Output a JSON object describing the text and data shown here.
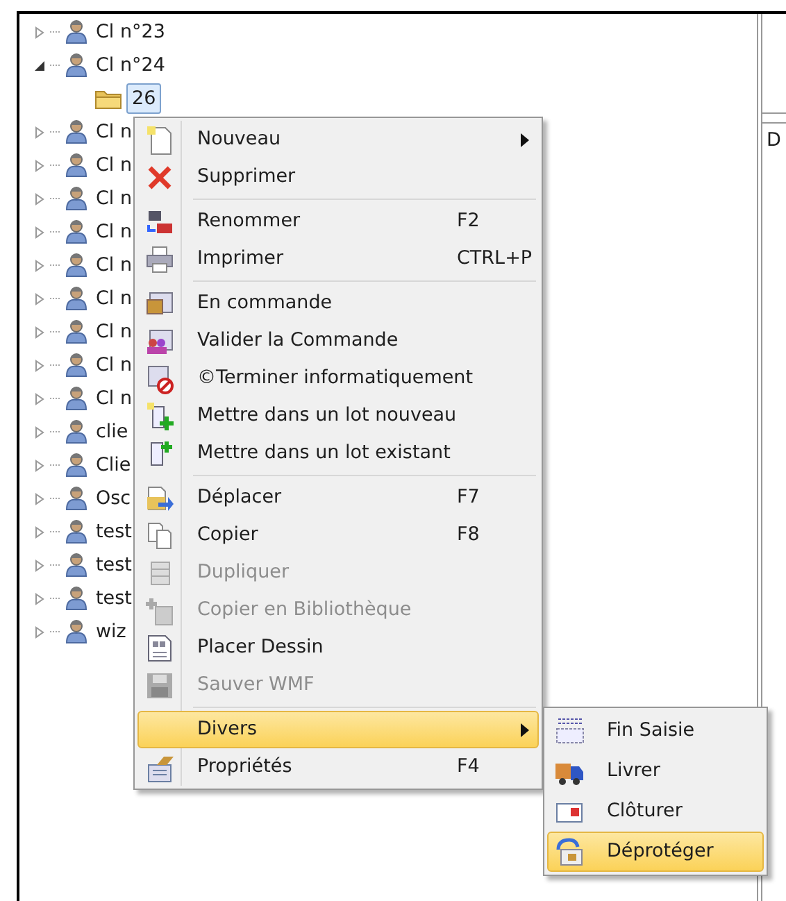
{
  "tree": {
    "items": [
      {
        "kind": "client",
        "label": "Cl n°23",
        "expanded": false,
        "selected": false
      },
      {
        "kind": "client",
        "label": "Cl n°24",
        "expanded": true,
        "selected": false,
        "children": [
          {
            "kind": "folder",
            "label": "26",
            "selected": true
          }
        ]
      },
      {
        "kind": "client",
        "label": "Cl n",
        "expanded": false,
        "selected": false
      },
      {
        "kind": "client",
        "label": "Cl n",
        "expanded": false,
        "selected": false
      },
      {
        "kind": "client",
        "label": "Cl n",
        "expanded": false,
        "selected": false
      },
      {
        "kind": "client",
        "label": "Cl n",
        "expanded": false,
        "selected": false
      },
      {
        "kind": "client",
        "label": "Cl n",
        "expanded": false,
        "selected": false
      },
      {
        "kind": "client",
        "label": "Cl n",
        "expanded": false,
        "selected": false
      },
      {
        "kind": "client",
        "label": "Cl n",
        "expanded": false,
        "selected": false
      },
      {
        "kind": "client",
        "label": "Cl n",
        "expanded": false,
        "selected": false
      },
      {
        "kind": "client",
        "label": "Cl n",
        "expanded": false,
        "selected": false
      },
      {
        "kind": "client",
        "label": "clie",
        "expanded": false,
        "selected": false
      },
      {
        "kind": "client",
        "label": "Clie",
        "expanded": false,
        "selected": false
      },
      {
        "kind": "client",
        "label": "Osc",
        "expanded": false,
        "selected": false
      },
      {
        "kind": "client",
        "label": "test",
        "expanded": false,
        "selected": false
      },
      {
        "kind": "client",
        "label": "test",
        "expanded": false,
        "selected": false
      },
      {
        "kind": "client",
        "label": "test",
        "expanded": false,
        "selected": false
      },
      {
        "kind": "client",
        "label": "wiz",
        "expanded": false,
        "selected": false
      }
    ]
  },
  "right_panel": {
    "label": "D"
  },
  "context_menu": {
    "items": [
      {
        "kind": "item",
        "label": "Nouveau",
        "has_submenu": true,
        "disabled": false,
        "selected": false
      },
      {
        "kind": "item",
        "label": "Supprimer",
        "disabled": false,
        "selected": false
      },
      {
        "kind": "separator"
      },
      {
        "kind": "item",
        "label": "Renommer",
        "shortcut": "F2",
        "disabled": false,
        "selected": false
      },
      {
        "kind": "item",
        "label": "Imprimer",
        "shortcut": "CTRL+P",
        "disabled": false,
        "selected": false
      },
      {
        "kind": "separator"
      },
      {
        "kind": "item",
        "label": "En commande",
        "disabled": false,
        "selected": false
      },
      {
        "kind": "item",
        "label": "Valider la Commande",
        "disabled": false,
        "selected": false
      },
      {
        "kind": "item",
        "label": "©Terminer informatiquement",
        "disabled": false,
        "selected": false
      },
      {
        "kind": "item",
        "label": "Mettre dans un lot nouveau",
        "disabled": false,
        "selected": false
      },
      {
        "kind": "item",
        "label": "Mettre dans un lot existant",
        "disabled": false,
        "selected": false
      },
      {
        "kind": "separator"
      },
      {
        "kind": "item",
        "label": "Déplacer",
        "shortcut": "F7",
        "disabled": false,
        "selected": false
      },
      {
        "kind": "item",
        "label": "Copier",
        "shortcut": "F8",
        "disabled": false,
        "selected": false
      },
      {
        "kind": "item",
        "label": "Dupliquer",
        "disabled": true,
        "selected": false
      },
      {
        "kind": "item",
        "label": "Copier en Bibliothèque",
        "disabled": true,
        "selected": false
      },
      {
        "kind": "item",
        "label": "Placer Dessin",
        "disabled": false,
        "selected": false
      },
      {
        "kind": "item",
        "label": "Sauver WMF",
        "disabled": true,
        "selected": false
      },
      {
        "kind": "separator"
      },
      {
        "kind": "item",
        "label": "Divers",
        "has_submenu": true,
        "disabled": false,
        "selected": true,
        "submenu": [
          {
            "label": "Fin Saisie",
            "selected": false
          },
          {
            "label": "Livrer",
            "selected": false
          },
          {
            "label": "Clôturer",
            "selected": false
          },
          {
            "label": "Déprotéger",
            "selected": true
          }
        ]
      },
      {
        "kind": "item",
        "label": "Propriétés",
        "shortcut": "F4",
        "disabled": false,
        "selected": false
      }
    ]
  }
}
